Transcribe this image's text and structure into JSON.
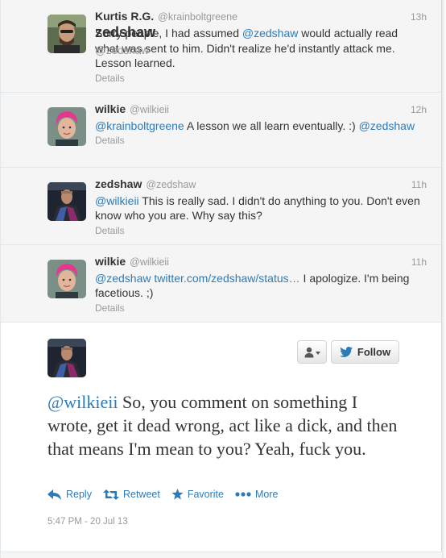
{
  "replies": [
    {
      "fullname": "Kurtis R.G.",
      "username": "@krainboltgreene",
      "time": "13h",
      "parts": [
        {
          "t": "Sorry people, I had assumed ",
          "c": "text"
        },
        {
          "t": "@zedshaw",
          "c": "mention"
        },
        {
          "t": " would actually read what was sent to him. Didn't realize he'd instantly attack me. Lesson learned.",
          "c": "text"
        }
      ],
      "details": "Details"
    },
    {
      "fullname": "wilkie",
      "username": "@wilkieii",
      "time": "12h",
      "parts": [
        {
          "t": "@krainboltgreene",
          "c": "mention"
        },
        {
          "t": " A lesson we all learn eventually. :) ",
          "c": "text"
        },
        {
          "t": "@zedshaw",
          "c": "mention"
        }
      ],
      "details": "Details"
    },
    {
      "fullname": "zedshaw",
      "username": "@zedshaw",
      "time": "11h",
      "parts": [
        {
          "t": "@wilkieii",
          "c": "mention"
        },
        {
          "t": " This is really sad. I didn't do anything to you. Don't even know who you are. Why say this?",
          "c": "text"
        }
      ],
      "details": "Details"
    },
    {
      "fullname": "wilkie",
      "username": "@wilkieii",
      "time": "11h",
      "parts": [
        {
          "t": "@zedshaw",
          "c": "mention"
        },
        {
          "t": " ",
          "c": "text"
        },
        {
          "t": "twitter.com/zedshaw/status…",
          "c": "link"
        },
        {
          "t": " I apologize. I'm being facetious. ;)",
          "c": "text"
        }
      ],
      "details": "Details"
    }
  ],
  "main": {
    "fullname": "zedshaw",
    "username": "@zedshaw",
    "follow_label": "Follow",
    "mention": "@wilkieii",
    "text": " So, you comment on something I wrote, get it dead wrong, act like a dick, and then that means I'm mean to you? Yeah, fuck you.",
    "actions": {
      "reply": "Reply",
      "retweet": "Retweet",
      "favorite": "Favorite",
      "more": "More"
    },
    "timestamp": "5:47 PM - 20 Jul 13"
  },
  "colors": {
    "link": "#2b7bb9",
    "muted": "#999999",
    "reply_bg": "#f5f5f5"
  },
  "icons": [
    "user-icon",
    "twitter-bird-icon",
    "reply-icon",
    "retweet-icon",
    "favorite-icon",
    "more-icon"
  ]
}
